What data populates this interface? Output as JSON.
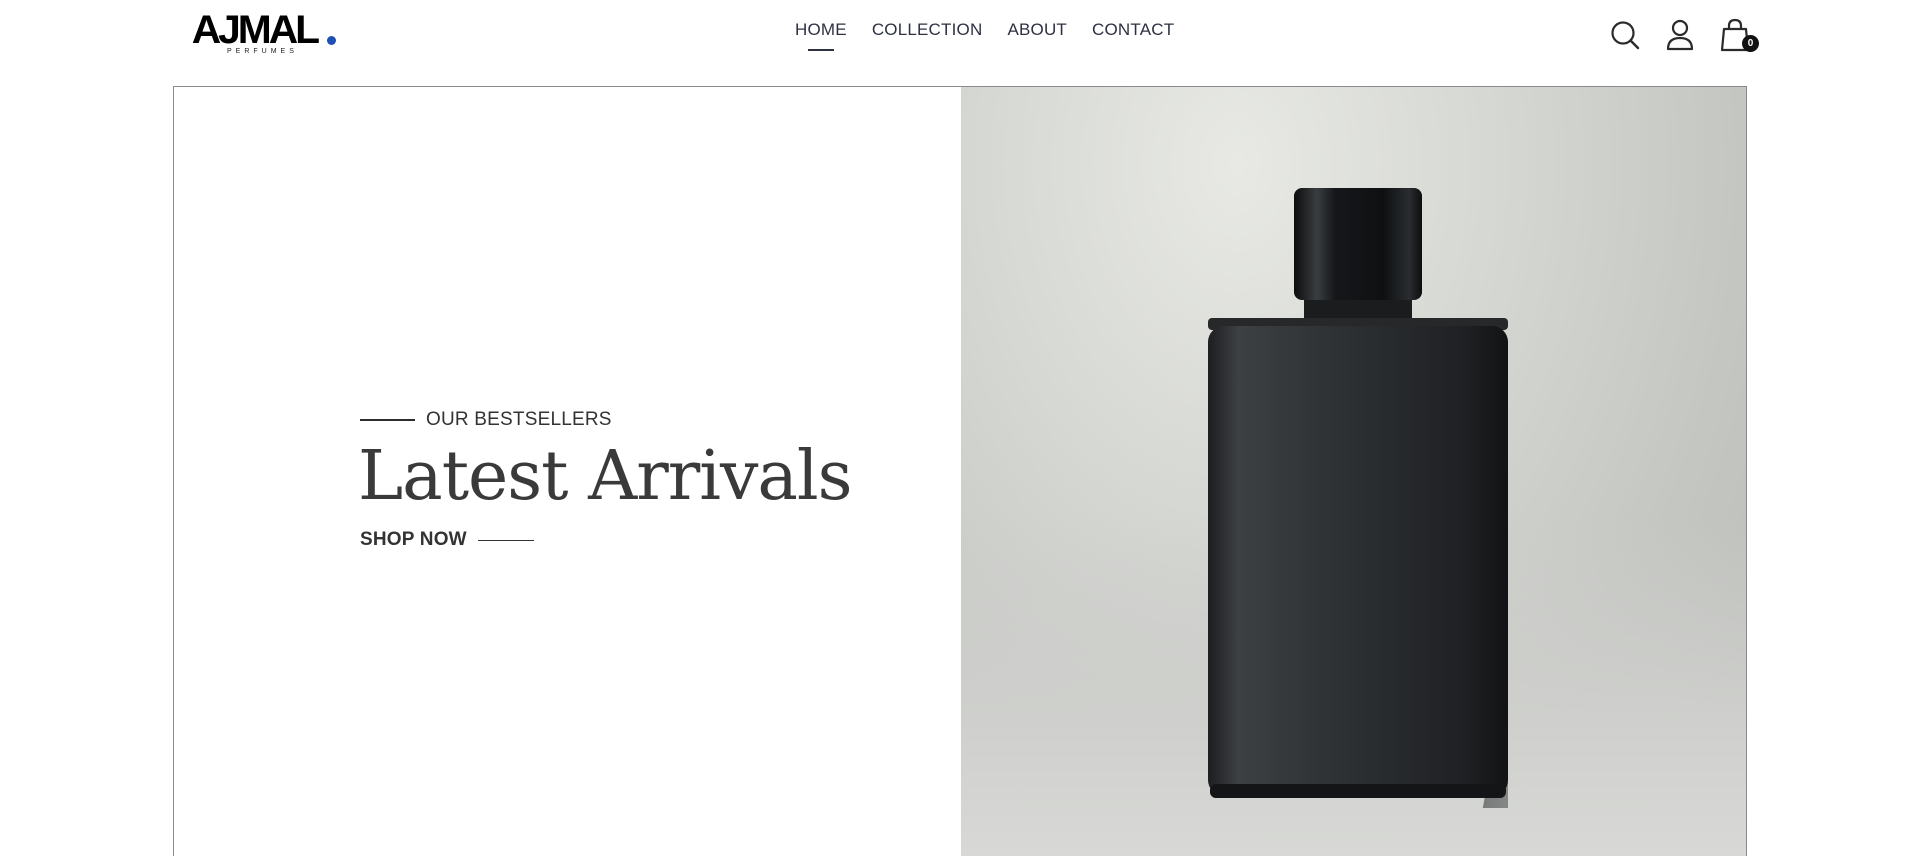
{
  "brand": {
    "name": "AJMAL",
    "sub": "PERFUMES"
  },
  "nav": {
    "items": [
      {
        "label": "HOME",
        "active": true
      },
      {
        "label": "COLLECTION",
        "active": false
      },
      {
        "label": "ABOUT",
        "active": false
      },
      {
        "label": "CONTACT",
        "active": false
      }
    ]
  },
  "header_icons": {
    "search": "search-icon",
    "account": "user-icon",
    "cart": "shopping-bag-icon",
    "cart_count": "0"
  },
  "hero": {
    "eyebrow": "OUR BESTSELLERS",
    "title": "Latest Arrivals",
    "cta": "SHOP NOW",
    "image": "black-perfume-bottle"
  },
  "colors": {
    "accent_dot": "#1e4fb4",
    "nav_text": "#2d3142",
    "headline": "#3a3a3a"
  }
}
